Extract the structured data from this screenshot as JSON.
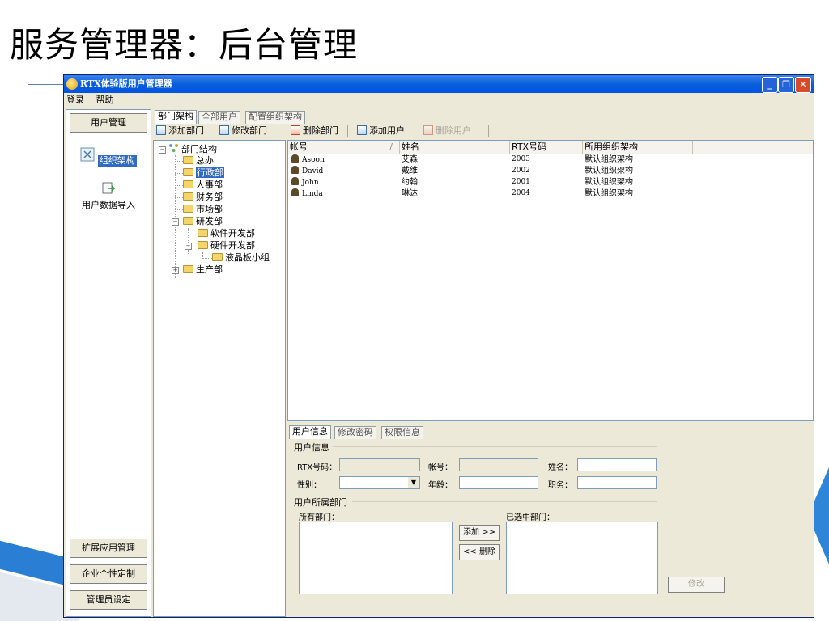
{
  "slide": {
    "title": "服务管理器：后台管理"
  },
  "window": {
    "title": "RTX体验版用户管理器",
    "controls": {
      "minimize": "_",
      "maximize": "❐",
      "close": "✕"
    }
  },
  "menu": [
    "登录",
    "帮助"
  ],
  "left_panel": {
    "top_button": "用户管理",
    "items": [
      {
        "label": "组织架构",
        "icon": "org-structure-icon",
        "selected": true
      },
      {
        "label": "用户数据导入",
        "icon": "import-icon",
        "selected": false
      }
    ],
    "bottom_buttons": [
      "扩展应用管理",
      "企业个性定制",
      "管理员设定"
    ]
  },
  "main_tabs": [
    "部门架构",
    "全部用户",
    "配置组织架构"
  ],
  "toolbar": {
    "add_dept": "添加部门",
    "edit_dept": "修改部门",
    "del_dept": "删除部门",
    "add_user": "添加用户",
    "del_user": "删除用户"
  },
  "tree": {
    "root": "部门结构",
    "nodes": [
      "总办",
      "行政部",
      "人事部",
      "财务部",
      "市场部",
      "研发部",
      "软件开发部",
      "硬件开发部",
      "液晶板小组",
      "生产部"
    ],
    "selected": "行政部",
    "expander_minus": "−",
    "expander_plus": "+"
  },
  "user_list": {
    "columns": [
      "帐号",
      "姓名",
      "RTX号码",
      "所用组织架构"
    ],
    "sort_indicator": "/",
    "rows": [
      {
        "account": "Asoon",
        "name": "艾森",
        "rtx": "2003",
        "org": "默认组织架构"
      },
      {
        "account": "David",
        "name": "戴维",
        "rtx": "2002",
        "org": "默认组织架构"
      },
      {
        "account": "John",
        "name": "约翰",
        "rtx": "2001",
        "org": "默认组织架构"
      },
      {
        "account": "Linda",
        "name": "琳达",
        "rtx": "2004",
        "org": "默认组织架构"
      }
    ]
  },
  "detail_tabs": [
    "用户信息",
    "修改密码",
    "权限信息"
  ],
  "user_info": {
    "group_label": "用户信息",
    "rtx_label": "RTX号码：",
    "account_label": "帐号：",
    "name_label": "姓名：",
    "gender_label": "性别：",
    "age_label": "年龄：",
    "job_label": "职务：",
    "dept_group_label": "用户所属部门",
    "all_depts_label": "所有部门：",
    "selected_depts_label": "已选中部门：",
    "add_button": "添加 >>",
    "remove_button": "<< 删除",
    "modify_button": "修改"
  }
}
